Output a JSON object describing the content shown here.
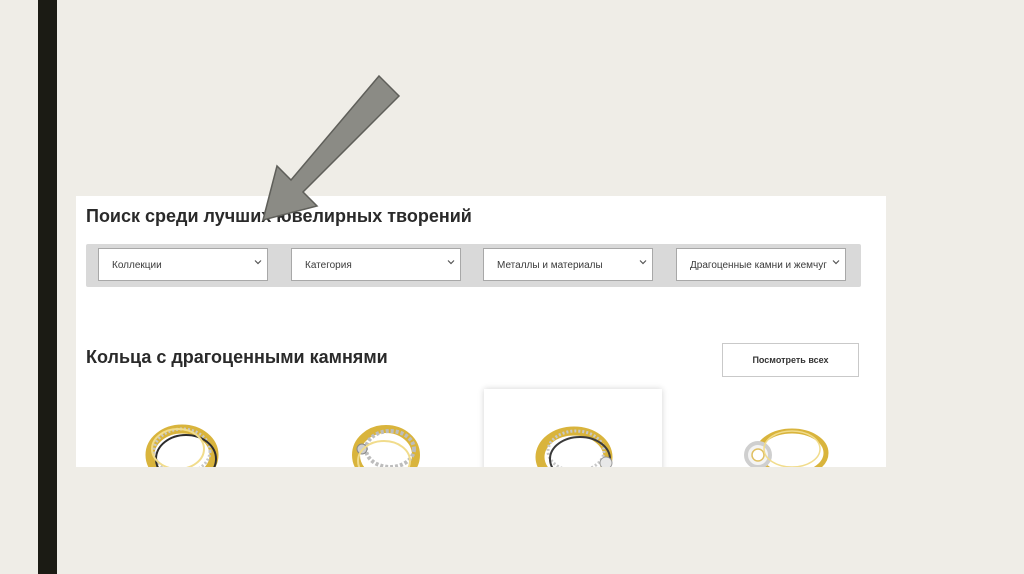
{
  "search": {
    "title": "Поиск среди лучших ювелирных творений"
  },
  "filters": [
    {
      "label": "Коллекции",
      "icon": "chevron-down-icon"
    },
    {
      "label": "Категория",
      "icon": "chevron-down-icon"
    },
    {
      "label": "Металлы и материалы",
      "icon": "chevron-down-icon"
    },
    {
      "label": "Драгоценные камни и жемчуг",
      "icon": "chevron-down-icon"
    }
  ],
  "rings_section": {
    "title": "Кольца с драгоценными камнями",
    "view_all_label": "Посмотреть всех",
    "products": [
      {
        "icon": "ring-image"
      },
      {
        "icon": "ring-image"
      },
      {
        "icon": "ring-image",
        "highlighted": true
      },
      {
        "icon": "ring-image"
      }
    ]
  },
  "annotation": {
    "icon": "arrow-icon",
    "color": "#8b8b85"
  },
  "colors": {
    "gold": "#d9b43c",
    "background": "#efede7",
    "sidebar": "#1b1b14"
  }
}
